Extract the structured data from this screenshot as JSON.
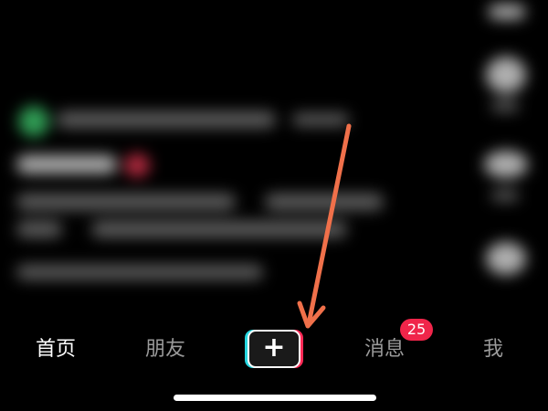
{
  "tabbar": {
    "home_label": "首页",
    "friends_label": "朋友",
    "create_icon": "plus-icon",
    "messages_label": "消息",
    "messages_badge": "25",
    "me_label": "我"
  },
  "colors": {
    "background": "#000000",
    "active_tab": "#ffffff",
    "inactive_tab": "#9a9a9a",
    "badge": "#f0254a",
    "annotation_arrow": "#f0704a",
    "create_cyan": "#25d6e0",
    "create_pink": "#ff2a56"
  }
}
